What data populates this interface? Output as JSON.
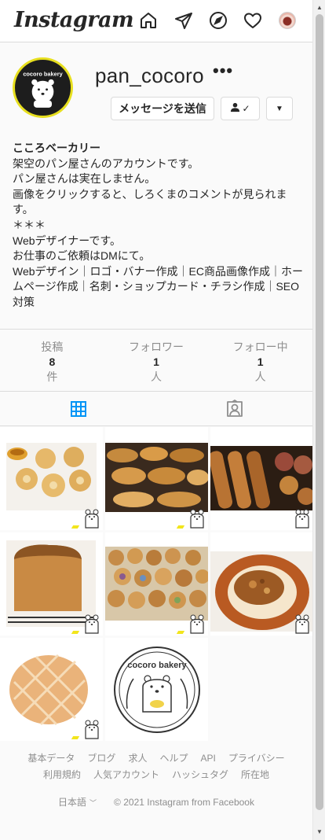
{
  "header": {
    "logo": "Instagram",
    "icons": [
      "home-icon",
      "direct-icon",
      "explore-icon",
      "activity-icon",
      "profile-avatar"
    ]
  },
  "profile": {
    "username": "pan_cocoro",
    "more": "•••",
    "message_button": "メッセージを送信",
    "follow_button": "✓",
    "dropdown": "▼",
    "avatar_text": "cocoro bakery",
    "display_name": "こころベーカリー",
    "bio": "架空のパン屋さんのアカウントです。\nパン屋さんは実在しません。\n画像をクリックすると、しろくまのコメントが見られます。\n＊＊＊\nWebデザイナーです。\nお仕事のご依頼はDMにて。\nWebデザイン｜ロゴ・バナー作成｜EC商品画像作成｜ホームページ作成｜名刺・ショップカード・チラシ作成｜SEO対策"
  },
  "stats": [
    {
      "label": "投稿",
      "value": "8",
      "unit": "件"
    },
    {
      "label": "フォロワー",
      "value": "1",
      "unit": "人"
    },
    {
      "label": "フォロー中",
      "value": "1",
      "unit": "人"
    }
  ],
  "tabs": [
    "posts-grid-tab",
    "tagged-tab"
  ],
  "posts": [
    {
      "name": "post-melonpan-tea"
    },
    {
      "name": "post-pastries-display"
    },
    {
      "name": "post-baguettes"
    },
    {
      "name": "post-shokupan"
    },
    {
      "name": "post-assorted-buns"
    },
    {
      "name": "post-curry-bread"
    },
    {
      "name": "post-melonpan"
    },
    {
      "name": "post-logo",
      "logo_text": "cocoro bakery"
    }
  ],
  "footer": {
    "links": [
      "基本データ",
      "ブログ",
      "求人",
      "ヘルプ",
      "API",
      "プライバシー",
      "利用規約",
      "人気アカウント",
      "ハッシュタグ",
      "所在地"
    ],
    "language": "日本語",
    "copyright": "© 2021 Instagram from Facebook"
  },
  "colors": {
    "avatar_ring": "#e7df1e",
    "active_tab": "#0095f6",
    "text": "#262626",
    "muted": "#8e8e8e"
  }
}
